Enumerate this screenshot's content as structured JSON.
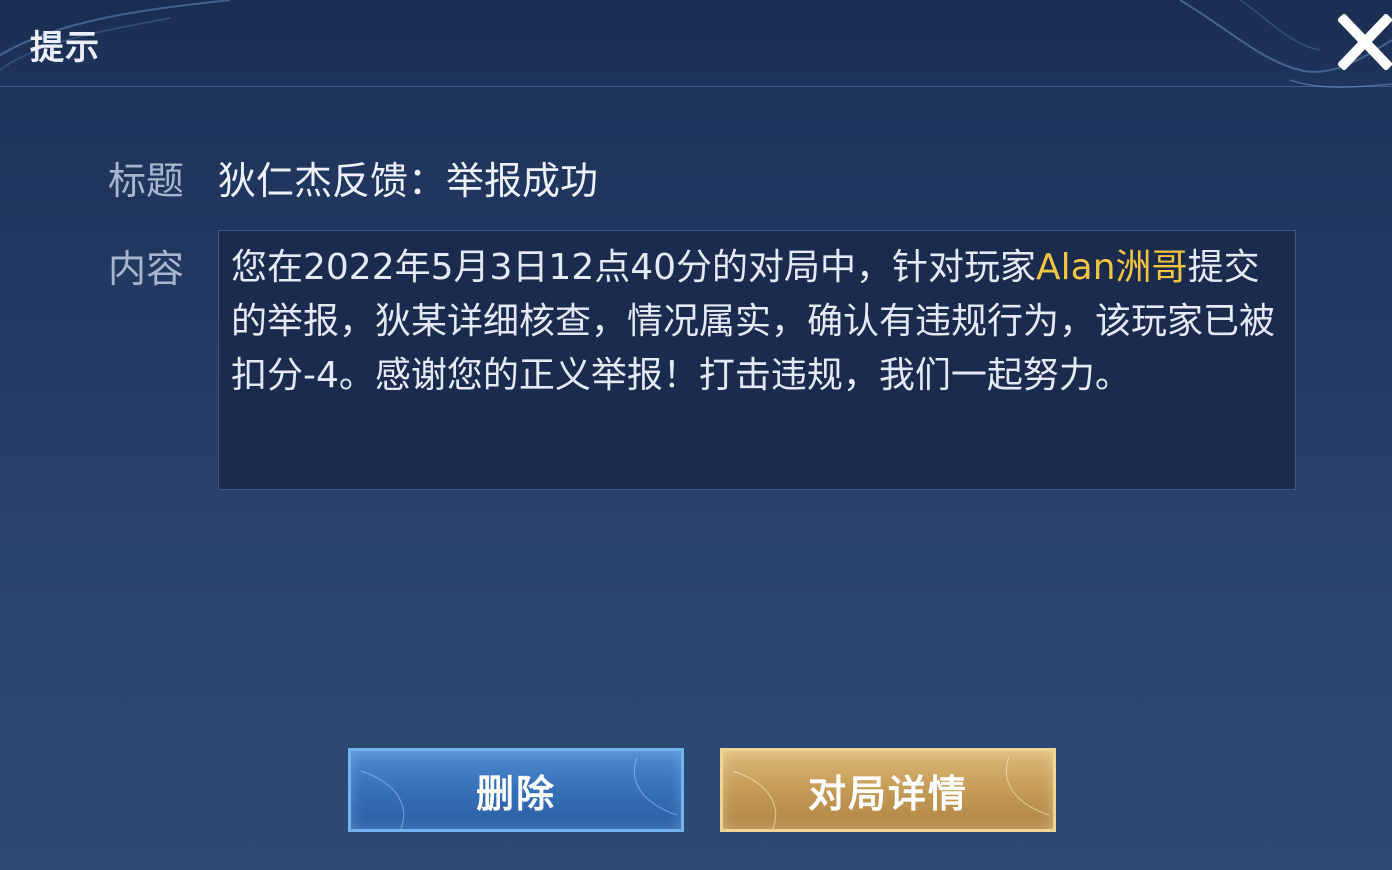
{
  "dialog": {
    "title": "提示"
  },
  "message": {
    "title_label": "标题",
    "subject": "狄仁杰反馈：举报成功",
    "content_label": "内容",
    "content_before": "您在2022年5月3日12点40分的对局中，针对玩家",
    "player_name": "Alan洲哥",
    "content_after": "提交的举报，狄某详细核查，情况属实，确认有违规行为，该玩家已被扣分-4。感谢您的正义举报！打击违规，我们一起努力。"
  },
  "buttons": {
    "delete_label": "删除",
    "detail_label": "对局详情"
  },
  "colors": {
    "highlight": "#f3c440",
    "delete_button": "#3670b8",
    "detail_button": "#c49a55"
  }
}
